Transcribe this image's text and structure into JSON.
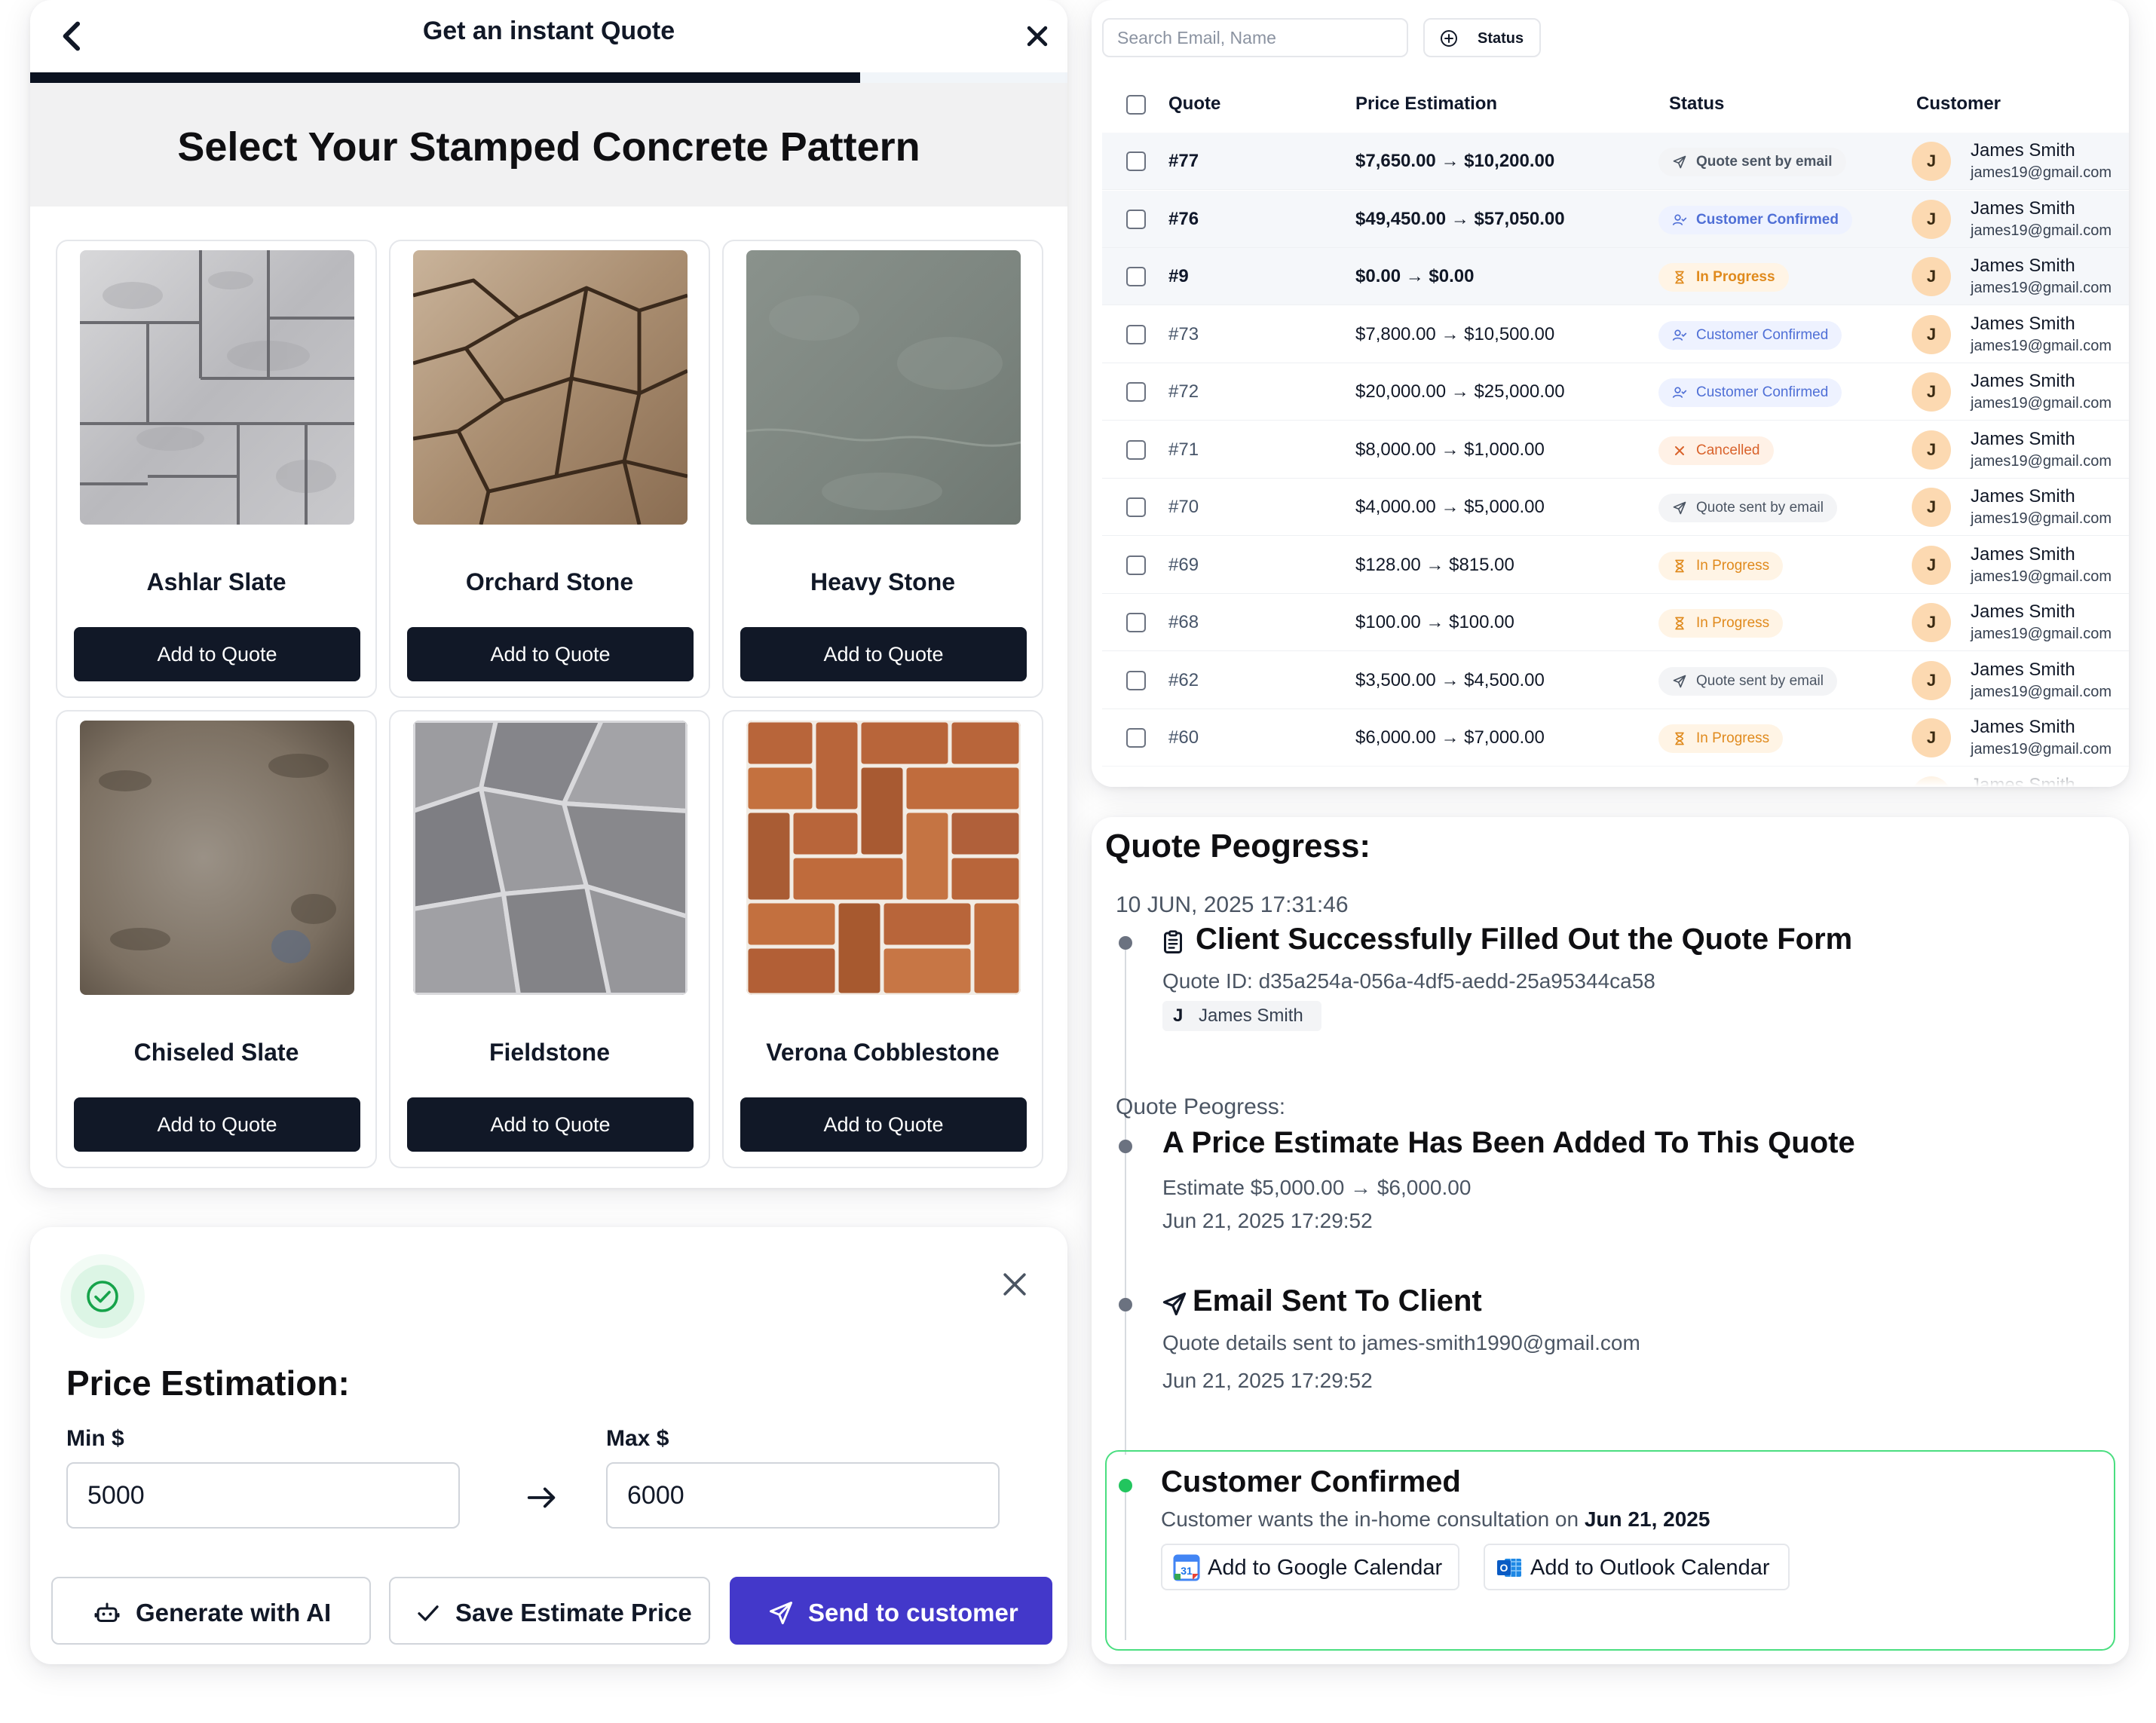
{
  "quote_wizard": {
    "title": "Get an instant Quote",
    "progress_fraction": 0.8,
    "heading": "Select Your Stamped Concrete Pattern",
    "patterns": [
      {
        "name": "Ashlar Slate",
        "button": "Add to Quote"
      },
      {
        "name": "Orchard Stone",
        "button": "Add to Quote"
      },
      {
        "name": "Heavy Stone",
        "button": "Add to Quote"
      },
      {
        "name": "Chiseled Slate",
        "button": "Add to Quote"
      },
      {
        "name": "Fieldstone",
        "button": "Add to Quote"
      },
      {
        "name": "Verona Cobblestone",
        "button": "Add to Quote"
      }
    ]
  },
  "quotes_table": {
    "search_placeholder": "Search Email, Name",
    "status_filter": "Status",
    "columns": {
      "quote": "Quote",
      "price": "Price Estimation",
      "status": "Status",
      "customer": "Customer"
    },
    "rows": [
      {
        "id": "#77",
        "price": "$7,650.00 → $10,200.00",
        "status": "Quote sent by email",
        "kind": "email",
        "avatar": "J",
        "name": "James Smith",
        "email": "james19@gmail.com"
      },
      {
        "id": "#76",
        "price": "$49,450.00 → $57,050.00",
        "status": "Customer Confirmed",
        "kind": "confirmed",
        "avatar": "J",
        "name": "James Smith",
        "email": "james19@gmail.com"
      },
      {
        "id": "#9",
        "price": "$0.00 → $0.00",
        "status": "In Progress",
        "kind": "progress",
        "avatar": "J",
        "name": "James Smith",
        "email": "james19@gmail.com"
      },
      {
        "id": "#73",
        "price": "$7,800.00 → $10,500.00",
        "status": "Customer Confirmed",
        "kind": "confirmed",
        "avatar": "J",
        "name": "James Smith",
        "email": "james19@gmail.com"
      },
      {
        "id": "#72",
        "price": "$20,000.00 → $25,000.00",
        "status": "Customer Confirmed",
        "kind": "confirmed",
        "avatar": "J",
        "name": "James Smith",
        "email": "james19@gmail.com"
      },
      {
        "id": "#71",
        "price": "$8,000.00 → $1,000.00",
        "status": "Cancelled",
        "kind": "cancelled",
        "avatar": "J",
        "name": "James Smith",
        "email": "james19@gmail.com"
      },
      {
        "id": "#70",
        "price": "$4,000.00 → $5,000.00",
        "status": "Quote sent by email",
        "kind": "email",
        "avatar": "J",
        "name": "James Smith",
        "email": "james19@gmail.com"
      },
      {
        "id": "#69",
        "price": "$128.00 → $815.00",
        "status": "In Progress",
        "kind": "progress",
        "avatar": "J",
        "name": "James Smith",
        "email": "james19@gmail.com"
      },
      {
        "id": "#68",
        "price": "$100.00 → $100.00",
        "status": "In Progress",
        "kind": "progress",
        "avatar": "J",
        "name": "James Smith",
        "email": "james19@gmail.com"
      },
      {
        "id": "#62",
        "price": "$3,500.00 → $4,500.00",
        "status": "Quote sent by email",
        "kind": "email",
        "avatar": "J",
        "name": "James Smith",
        "email": "james19@gmail.com"
      },
      {
        "id": "#60",
        "price": "$6,000.00 → $7,000.00",
        "status": "In Progress",
        "kind": "progress",
        "avatar": "J",
        "name": "James Smith",
        "email": "james19@gmail.com"
      },
      {
        "id": "",
        "price": "",
        "status": "",
        "kind": "email",
        "avatar": "J",
        "name": "James Smith",
        "email": ""
      }
    ]
  },
  "price_estimation": {
    "title": "Price Estimation:",
    "min_label": "Min $",
    "max_label": "Max $",
    "min_value": "5000",
    "max_value": "6000",
    "generate_ai": "Generate with AI",
    "save": "Save Estimate Price",
    "send": "Send to customer"
  },
  "quote_progress": {
    "title": "Quote Peogress:",
    "first_date": "10 JUN, 2025 17:31:46",
    "event1_title": "Client Successfully Filled Out the Quote Form",
    "event1_sub": "Quote ID: d35a254a-056a-4df5-aedd-25a95344ca58",
    "event1_chip_initial": "J",
    "event1_chip_name": "James Smith",
    "section_label": "Quote Peogress:",
    "event2_title": "A Price Estimate Has Been Added To This Quote",
    "event2_sub": "Estimate $5,000.00 → $6,000.00",
    "event2_time": "Jun 21, 2025 17:29:52",
    "event3_title": "Email Sent To Client",
    "event3_sub": "Quote details sent to james-smith1990@gmail.com",
    "event3_time": "Jun 21, 2025 17:29:52",
    "event4_title": "Customer Confirmed",
    "event4_sub_prefix": "Customer wants the in-home consultation on ",
    "event4_date": "Jun 21, 2025",
    "google_cal": "Add to Google Calendar",
    "outlook_cal": "Add to Outlook Calendar"
  }
}
